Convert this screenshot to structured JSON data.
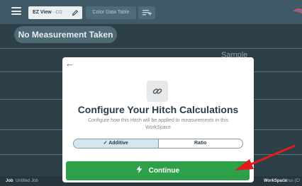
{
  "header": {
    "tabs": [
      {
        "label": "EZ View",
        "sublabel": "- C/2"
      },
      {
        "label": "Color Data Table"
      }
    ]
  },
  "workspace": {
    "measurement_status": "No Measurement Taken",
    "column_header": "Sample"
  },
  "footer": {
    "job_label": "Job",
    "job_value": "Untitled Job",
    "workspace_label": "WorkSpace",
    "workspace_value": "Citrus (C/"
  },
  "modal": {
    "title": "Configure Your Hitch Calculations",
    "subtitle": "Configure how this Hitch will be applied to measurements in this WorkSpace",
    "options": [
      {
        "label": "✓ Additive",
        "selected": true
      },
      {
        "label": "Ratio",
        "selected": false
      }
    ],
    "continue_label": "Continue"
  },
  "icons": [
    "menu-icon",
    "pencil-icon",
    "add-tab-icon",
    "brand-logo-icon",
    "back-arrow-icon",
    "hitch-link-icon",
    "lightning-icon"
  ],
  "colors": {
    "topbar": "#3f5a66",
    "continue_button": "#2ea04a",
    "selected_option": "#d4e6ee",
    "annotation_arrow": "#e21b1b"
  }
}
